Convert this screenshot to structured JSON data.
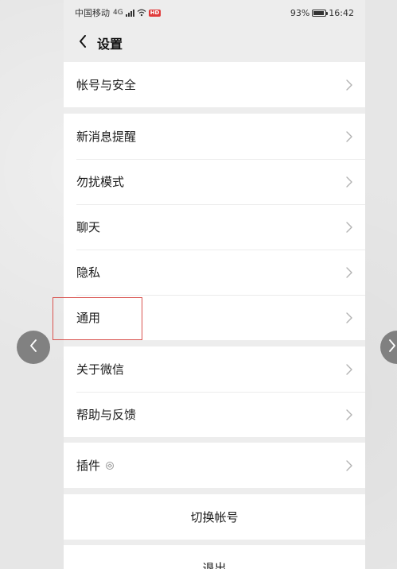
{
  "status_bar": {
    "carrier": "中国移动",
    "network": "4G",
    "hd_badge": "HD",
    "battery_percent": "93%",
    "battery_level": 0.93,
    "time": "16:42"
  },
  "nav": {
    "title": "设置"
  },
  "groups": [
    {
      "items": [
        {
          "label": "帐号与安全"
        }
      ]
    },
    {
      "items": [
        {
          "label": "新消息提醒"
        },
        {
          "label": "勿扰模式"
        },
        {
          "label": "聊天"
        },
        {
          "label": "隐私"
        },
        {
          "label": "通用"
        }
      ]
    },
    {
      "items": [
        {
          "label": "关于微信"
        },
        {
          "label": "帮助与反馈"
        }
      ]
    },
    {
      "items": [
        {
          "label": "插件"
        }
      ]
    }
  ],
  "actions": {
    "switch_account": "切换帐号",
    "logout": "退出"
  },
  "colors": {
    "highlight_border": "#d9534f",
    "page_background": "#ededed",
    "cell_background": "#ffffff"
  }
}
